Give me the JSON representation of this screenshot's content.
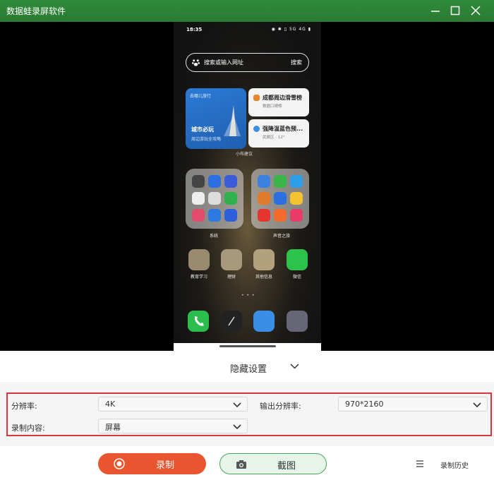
{
  "window": {
    "title": "数据蛙录屏软件",
    "accent": "#2e7d32"
  },
  "phone": {
    "time": "18:35",
    "status_icons": "◉ ✱ ▯ 5G 4G ▮",
    "search_placeholder": "搜索或输入网址",
    "search_button": "搜索",
    "travel_card": {
      "header": "去哪儿旅行",
      "title": "城市必玩",
      "subtitle": "周边游玩全攻略"
    },
    "suggest_cards": [
      {
        "title": "成都周边滑雪榜",
        "subtitle": "数据口碑榜"
      },
      {
        "title": "强降温蓝色预...",
        "subtitle": "武侯区 · 12°"
      }
    ],
    "suggest_label": "小布建议",
    "folders": [
      {
        "label": "系统"
      },
      {
        "label": "声音之旅"
      }
    ],
    "apps": [
      {
        "label": "教育学习"
      },
      {
        "label": "理财"
      },
      {
        "label": "其他信息"
      },
      {
        "label": "微信"
      }
    ]
  },
  "settings_toggle": {
    "label": "隐藏设置"
  },
  "settings": {
    "resolution_label": "分辨率:",
    "resolution_value": "4K",
    "output_resolution_label": "输出分辨率:",
    "output_resolution_value": "970*2160",
    "content_label": "录制内容:",
    "content_value": "屏幕",
    "highlight_color": "#d7383f"
  },
  "bottom": {
    "record_label": "录制",
    "screenshot_label": "截图",
    "history_label": "录制历史",
    "record_color": "#e8552f"
  }
}
